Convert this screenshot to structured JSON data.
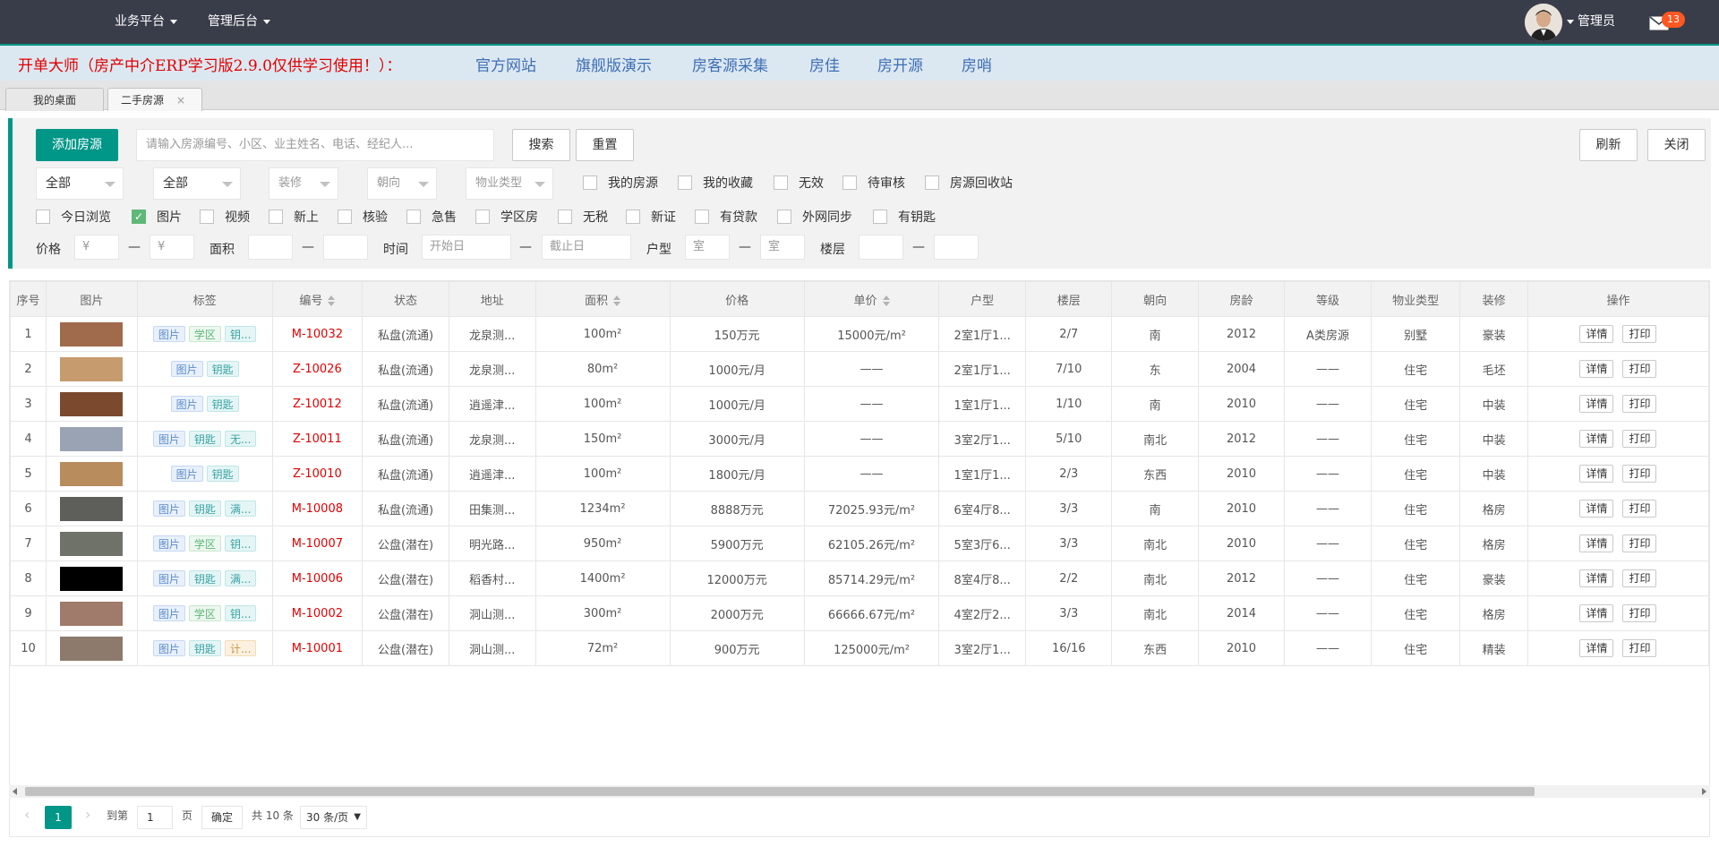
{
  "topbar": {
    "menus": [
      {
        "label": "业务平台"
      },
      {
        "label": "管理后台"
      }
    ],
    "user": "管理员",
    "mail_count": "13"
  },
  "banner": {
    "title": "开单大师（房产中介ERP学习版2.9.0仅供学习使用！）：",
    "links": [
      "官方网站",
      "旗舰版演示",
      "房客源采集",
      "房佳",
      "房开源",
      "房哨"
    ]
  },
  "tabs": [
    {
      "label": "我的桌面"
    },
    {
      "label": "二手房源",
      "close": "×"
    }
  ],
  "filters": {
    "add_button": "添加房源",
    "search_placeholder": "请输入房源编号、小区、业主姓名、电话、经纪人...",
    "search_button": "搜索",
    "reset_button": "重置",
    "refresh_button": "刷新",
    "close_button": "关闭",
    "selects": [
      {
        "value": "全部",
        "placeholder": false
      },
      {
        "value": "全部",
        "placeholder": false
      },
      {
        "value": "装修",
        "placeholder": true
      },
      {
        "value": "朝向",
        "placeholder": true
      },
      {
        "value": "物业类型",
        "placeholder": true
      }
    ],
    "checks_row1": [
      {
        "label": "我的房源",
        "checked": false
      },
      {
        "label": "我的收藏",
        "checked": false
      },
      {
        "label": "无效",
        "checked": false
      },
      {
        "label": "待审核",
        "checked": false
      },
      {
        "label": "房源回收站",
        "checked": false
      }
    ],
    "checks_row2": [
      {
        "label": "今日浏览",
        "checked": false
      },
      {
        "label": "图片",
        "checked": true
      },
      {
        "label": "视频",
        "checked": false
      },
      {
        "label": "新上",
        "checked": false
      },
      {
        "label": "核验",
        "checked": false
      },
      {
        "label": "急售",
        "checked": false
      },
      {
        "label": "学区房",
        "checked": false
      },
      {
        "label": "无税",
        "checked": false
      },
      {
        "label": "新证",
        "checked": false
      },
      {
        "label": "有贷款",
        "checked": false
      },
      {
        "label": "外网同步",
        "checked": false
      },
      {
        "label": "有钥匙",
        "checked": false
      }
    ],
    "range": {
      "price_label": "价格",
      "price_min_ph": "¥",
      "price_max_ph": "¥",
      "area_label": "面积",
      "time_label": "时间",
      "time_start_ph": "开始日",
      "time_end_ph": "截止日",
      "layout_label": "户型",
      "room_min_ph": "室",
      "room_max_ph": "室",
      "floor_label": "楼层",
      "dash": "—"
    }
  },
  "table": {
    "headers": [
      "序号",
      "图片",
      "标签",
      "编号",
      "状态",
      "地址",
      "面积",
      "价格",
      "单价",
      "户型",
      "楼层",
      "朝向",
      "房龄",
      "等级",
      "物业类型",
      "装修",
      "操作"
    ],
    "sortable": [
      "编号",
      "面积",
      "单价"
    ],
    "detail_label": "详情",
    "print_label": "打印",
    "rows": [
      {
        "no": "1",
        "photo": "#a06a4c",
        "tags": [
          [
            "图片",
            "blue"
          ],
          [
            "学区",
            "green"
          ],
          [
            "钥...",
            "teal"
          ]
        ],
        "code": "M-10032",
        "status": "私盘(流通)",
        "addr": "龙泉测...",
        "area": "100m²",
        "price": "150万元",
        "unit": "15000元/m²",
        "layout": "2室1厅1...",
        "floor": "2/7",
        "dir": "南",
        "age": "2012",
        "grade": "A类房源",
        "ptype": "别墅",
        "deco": "豪装"
      },
      {
        "no": "2",
        "photo": "#c69b6d",
        "tags": [
          [
            "图片",
            "blue"
          ],
          [
            "钥匙",
            "teal"
          ]
        ],
        "code": "Z-10026",
        "status": "私盘(流通)",
        "addr": "龙泉测...",
        "area": "80m²",
        "price": "1000元/月",
        "unit": "——",
        "layout": "2室1厅1...",
        "floor": "7/10",
        "dir": "东",
        "age": "2004",
        "grade": "——",
        "ptype": "住宅",
        "deco": "毛坯"
      },
      {
        "no": "3",
        "photo": "#7b4a2e",
        "tags": [
          [
            "图片",
            "blue"
          ],
          [
            "钥匙",
            "teal"
          ]
        ],
        "code": "Z-10012",
        "status": "私盘(流通)",
        "addr": "逍遥津...",
        "area": "100m²",
        "price": "1000元/月",
        "unit": "——",
        "layout": "1室1厅1...",
        "floor": "1/10",
        "dir": "南",
        "age": "2010",
        "grade": "——",
        "ptype": "住宅",
        "deco": "中装"
      },
      {
        "no": "4",
        "photo": "#9aa3b4",
        "tags": [
          [
            "图片",
            "blue"
          ],
          [
            "钥匙",
            "teal"
          ],
          [
            "无...",
            "teal"
          ]
        ],
        "code": "Z-10011",
        "status": "私盘(流通)",
        "addr": "龙泉测...",
        "area": "150m²",
        "price": "3000元/月",
        "unit": "——",
        "layout": "3室2厅1...",
        "floor": "5/10",
        "dir": "南北",
        "age": "2012",
        "grade": "——",
        "ptype": "住宅",
        "deco": "中装"
      },
      {
        "no": "5",
        "photo": "#b88c5d",
        "tags": [
          [
            "图片",
            "blue"
          ],
          [
            "钥匙",
            "teal"
          ]
        ],
        "code": "Z-10010",
        "status": "私盘(流通)",
        "addr": "逍遥津...",
        "area": "100m²",
        "price": "1800元/月",
        "unit": "——",
        "layout": "1室1厅1...",
        "floor": "2/3",
        "dir": "东西",
        "age": "2010",
        "grade": "——",
        "ptype": "住宅",
        "deco": "中装"
      },
      {
        "no": "6",
        "photo": "#5e5e5a",
        "tags": [
          [
            "图片",
            "blue"
          ],
          [
            "钥匙",
            "teal"
          ],
          [
            "满...",
            "teal"
          ]
        ],
        "code": "M-10008",
        "status": "私盘(流通)",
        "addr": "田集测...",
        "area": "1234m²",
        "price": "8888万元",
        "unit": "72025.93元/m²",
        "layout": "6室4厅8...",
        "floor": "3/3",
        "dir": "南",
        "age": "2010",
        "grade": "——",
        "ptype": "住宅",
        "deco": "格房"
      },
      {
        "no": "7",
        "photo": "#6f7268",
        "tags": [
          [
            "图片",
            "blue"
          ],
          [
            "学区",
            "green"
          ],
          [
            "钥...",
            "teal"
          ]
        ],
        "code": "M-10007",
        "status": "公盘(潜在)",
        "addr": "明光路...",
        "area": "950m²",
        "price": "5900万元",
        "unit": "62105.26元/m²",
        "layout": "5室3厅6...",
        "floor": "3/3",
        "dir": "南北",
        "age": "2010",
        "grade": "——",
        "ptype": "住宅",
        "deco": "格房"
      },
      {
        "no": "8",
        "photo": "#000000",
        "tags": [
          [
            "图片",
            "blue"
          ],
          [
            "钥匙",
            "teal"
          ],
          [
            "满...",
            "teal"
          ]
        ],
        "code": "M-10006",
        "status": "公盘(潜在)",
        "addr": "稻香村...",
        "area": "1400m²",
        "price": "12000万元",
        "unit": "85714.29元/m²",
        "layout": "8室4厅8...",
        "floor": "2/2",
        "dir": "南北",
        "age": "2012",
        "grade": "——",
        "ptype": "住宅",
        "deco": "豪装"
      },
      {
        "no": "9",
        "photo": "#a07a6a",
        "tags": [
          [
            "图片",
            "blue"
          ],
          [
            "学区",
            "green"
          ],
          [
            "钥...",
            "teal"
          ]
        ],
        "code": "M-10002",
        "status": "公盘(潜在)",
        "addr": "洞山测...",
        "area": "300m²",
        "price": "2000万元",
        "unit": "66666.67元/m²",
        "layout": "4室2厅2...",
        "floor": "3/3",
        "dir": "南北",
        "age": "2014",
        "grade": "——",
        "ptype": "住宅",
        "deco": "格房"
      },
      {
        "no": "10",
        "photo": "#8d7a6c",
        "tags": [
          [
            "图片",
            "blue"
          ],
          [
            "钥匙",
            "teal"
          ],
          [
            "计...",
            "orange"
          ]
        ],
        "code": "M-10001",
        "status": "公盘(潜在)",
        "addr": "洞山测...",
        "area": "72m²",
        "price": "900万元",
        "unit": "125000元/m²",
        "layout": "3室2厅1...",
        "floor": "16/16",
        "dir": "东西",
        "age": "2010",
        "grade": "——",
        "ptype": "住宅",
        "deco": "精装"
      }
    ]
  },
  "pager": {
    "current": "1",
    "goto_label": "到第",
    "page_value": "1",
    "page_unit": "页",
    "confirm": "确定",
    "total": "共 10 条",
    "per_page": "30 条/页"
  }
}
